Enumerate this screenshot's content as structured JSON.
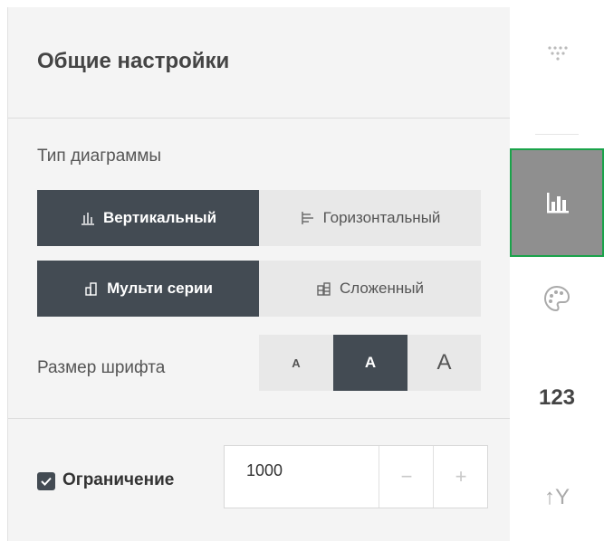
{
  "panel": {
    "title": "Общие настройки",
    "chart_type": {
      "label": "Тип диаграммы",
      "orientation": [
        {
          "label": "Вертикальный",
          "icon": "vertical-bars-icon",
          "active": true
        },
        {
          "label": "Горизонтальный",
          "icon": "horizontal-bars-icon",
          "active": false
        }
      ],
      "mode": [
        {
          "label": "Мульти серии",
          "icon": "multi-series-icon",
          "active": true
        },
        {
          "label": "Сложенный",
          "icon": "stacked-icon",
          "active": false
        }
      ]
    },
    "font_size": {
      "label": "Размер шрифта",
      "options": [
        {
          "label": "A",
          "active": false
        },
        {
          "label": "A",
          "active": true
        },
        {
          "label": "A",
          "active": false
        }
      ]
    },
    "limit": {
      "checked": true,
      "label": "Ограничение",
      "value": "1000",
      "minus": "−",
      "plus": "+"
    }
  },
  "rail": {
    "items": [
      {
        "icon": "dots-triangle-icon",
        "active": false
      },
      {
        "icon": "bar-chart-icon",
        "active": true
      },
      {
        "icon": "palette-icon",
        "active": false
      },
      {
        "text": "123",
        "icon": "numbers-icon",
        "active": false
      },
      {
        "text": "↑Y",
        "icon": "y-axis-icon",
        "active": false
      }
    ]
  },
  "colors": {
    "active_bg": "#434b53",
    "inactive_bg": "#e8e8e8",
    "panel_bg": "#f4f4f4",
    "rail_active_bg": "#8f8f8f",
    "rail_active_border": "#1aa34a"
  }
}
